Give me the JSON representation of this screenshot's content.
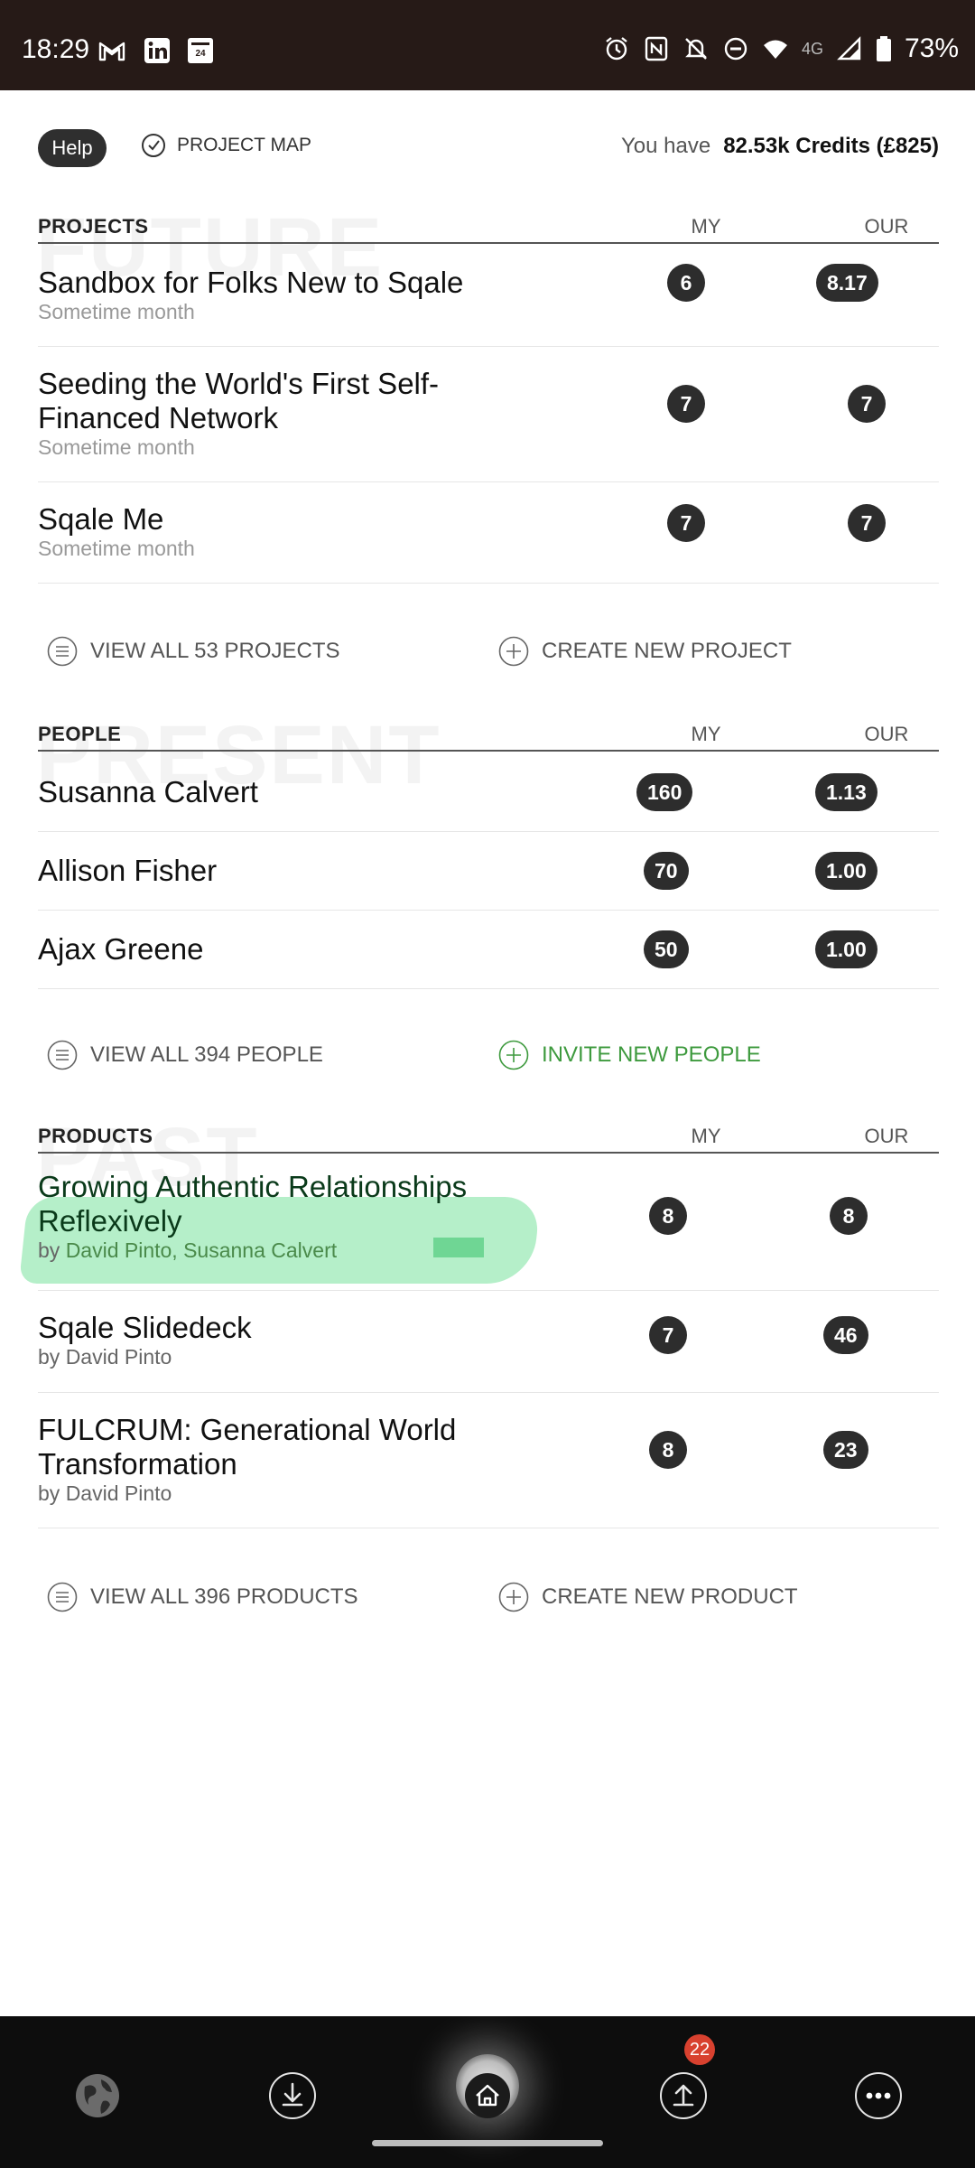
{
  "status_bar": {
    "time": "18:29",
    "network": "4G",
    "battery": "73%",
    "app_icons": [
      "gmail-icon",
      "linkedin-icon",
      "france24-icon"
    ],
    "system_icons": [
      "alarm-icon",
      "nfc-icon",
      "bell-off-icon",
      "dnd-icon",
      "wifi-icon",
      "signal-icon",
      "battery-icon"
    ]
  },
  "header": {
    "help_label": "Help",
    "project_map_label": "PROJECT MAP",
    "credits_prefix": "You have",
    "credits_value": "82.53k Credits (£825)"
  },
  "projects": {
    "watermark": "FUTURE",
    "title": "PROJECTS",
    "col_my": "MY",
    "col_our": "OUR",
    "rows": [
      {
        "title": "Sandbox for Folks New to Sqale",
        "sub": "Sometime month",
        "my": "6",
        "our": "8.17"
      },
      {
        "title": "Seeding the World's First Self-Financed Network",
        "sub": "Sometime month",
        "my": "7",
        "our": "7"
      },
      {
        "title": "Sqale Me",
        "sub": "Sometime month",
        "my": "7",
        "our": "7"
      }
    ],
    "view_all": "VIEW ALL 53 PROJECTS",
    "create_new": "CREATE NEW PROJECT"
  },
  "people": {
    "watermark": "PRESENT",
    "title": "PEOPLE",
    "col_my": "MY",
    "col_our": "OUR",
    "rows": [
      {
        "name": "Susanna Calvert",
        "my": "160",
        "our": "1.13"
      },
      {
        "name": "Allison Fisher",
        "my": "70",
        "our": "1.00"
      },
      {
        "name": "Ajax Greene",
        "my": "50",
        "our": "1.00"
      }
    ],
    "view_all": "VIEW ALL 394 PEOPLE",
    "invite_new": "INVITE NEW PEOPLE"
  },
  "products": {
    "watermark": "PAST",
    "title": "PRODUCTS",
    "col_my": "MY",
    "col_our": "OUR",
    "rows": [
      {
        "title": "Growing Authentic Relationships Reflexively",
        "by": "by",
        "authors": "David Pinto, Susanna Calvert",
        "my": "8",
        "our": "8"
      },
      {
        "title": "Sqale Slidedeck",
        "by": "by",
        "authors": "David Pinto",
        "my": "7",
        "our": "46"
      },
      {
        "title": "FULCRUM: Generational World Transformation",
        "by": "by",
        "authors": "David Pinto",
        "my": "8",
        "our": "23"
      }
    ],
    "view_all": "VIEW ALL 396 PRODUCTS",
    "create_new": "CREATE NEW PRODUCT"
  },
  "bottom_nav": {
    "items": [
      "globe-icon",
      "download-icon",
      "home-icon",
      "upload-icon",
      "more-icon"
    ],
    "upload_badge": "22"
  }
}
